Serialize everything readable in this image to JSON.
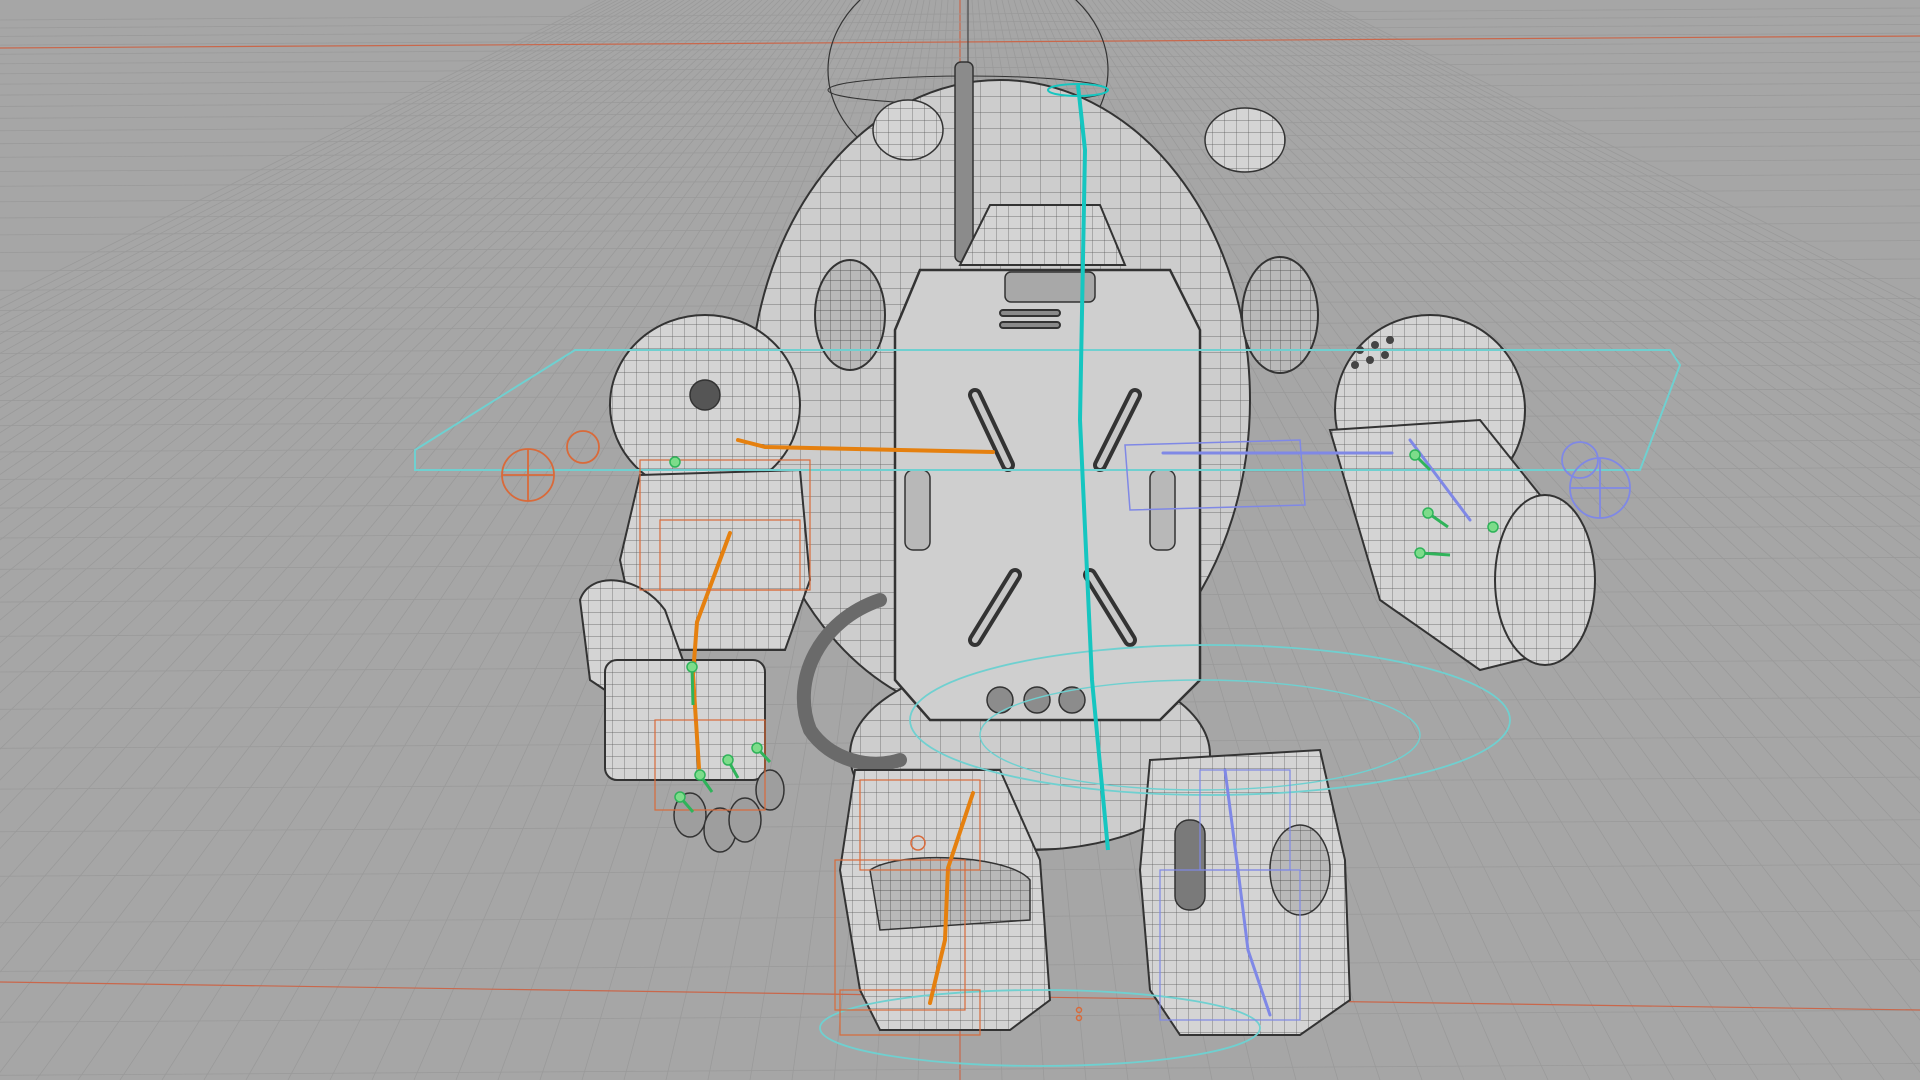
{
  "viewport": {
    "view": "perspective",
    "shading": "wireframe-on-shaded",
    "model": "character-robot",
    "selected_control": "root-spine-control"
  },
  "colors": {
    "background": "#a6a6a6",
    "grid_line": "#9a9a9a",
    "grid_axis": "#c9674b",
    "mesh_fill": "#cfcfcf",
    "mesh_wire": "#4a4a4a",
    "spine_cyan": "#16c6c0",
    "control_cyan": "#6fd0d0",
    "left_rig_orange": "#e5800f",
    "left_rig_thin": "#d96a3a",
    "right_rig_blue": "#7f88e6",
    "joint_green": "#2fb35a",
    "joint_fill": "#7ddc8a"
  },
  "rig": {
    "left_side": "orange",
    "right_side": "blue",
    "center": "cyan"
  }
}
